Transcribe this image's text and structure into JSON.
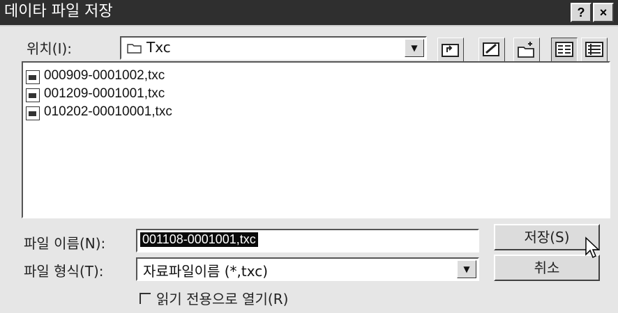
{
  "window": {
    "title": "데이타 파일 저장",
    "help_label": "?",
    "close_label": "×"
  },
  "location": {
    "label": "위치(I):",
    "value": "Txc"
  },
  "toolbar": {
    "up_icon": "folder-up-icon",
    "desktop_icon": "desktop-icon",
    "new_folder_icon": "new-folder-icon",
    "list_icon": "list-view-icon",
    "details_icon": "details-view-icon"
  },
  "files": [
    {
      "name": "000909-0001002,txc"
    },
    {
      "name": "001209-0001001,txc"
    },
    {
      "name": "010202-00010001,txc"
    }
  ],
  "filename": {
    "label": "파일 이름(N):",
    "value": "001108-0001001,txc"
  },
  "filetype": {
    "label": "파일 형식(T):",
    "value": "자료파일이름 (*,txc)"
  },
  "readonly": {
    "label": "읽기 전용으로 열기(R)"
  },
  "buttons": {
    "save": "저장(S)",
    "cancel": "취소"
  }
}
